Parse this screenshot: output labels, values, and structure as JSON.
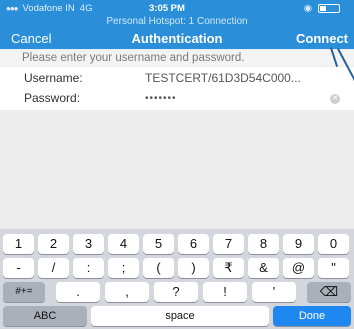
{
  "status": {
    "carrier": "Vodafone IN",
    "network": "4G",
    "time": "3:05 PM",
    "hotspot": "Personal Hotspot: 1 Connection"
  },
  "nav": {
    "cancel": "Cancel",
    "title": "Authentication",
    "connect": "Connect"
  },
  "form": {
    "prompt": "Please enter your username and password.",
    "username_label": "Username:",
    "username_value": "TESTCERT/61D3D54C000...",
    "password_label": "Password:",
    "password_value": "•••••••"
  },
  "keyboard": {
    "row1": [
      "1",
      "2",
      "3",
      "4",
      "5",
      "6",
      "7",
      "8",
      "9",
      "0"
    ],
    "row2": [
      "-",
      "/",
      ":",
      ";",
      "(",
      ")",
      "₹",
      "&",
      "@",
      "\""
    ],
    "row3": {
      "left": "#+=",
      "keys": [
        ".",
        ",",
        "?",
        "!",
        "'"
      ],
      "right": "⌫"
    },
    "row4": {
      "abc": "ABC",
      "space": "space",
      "done": "Done"
    }
  }
}
